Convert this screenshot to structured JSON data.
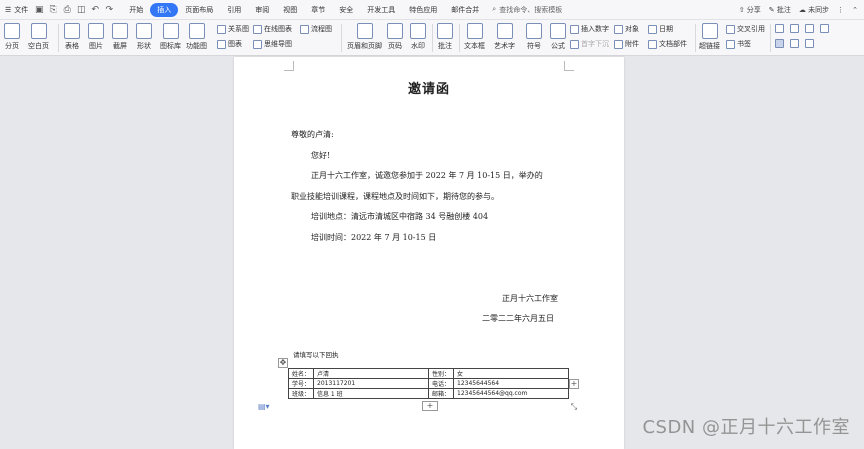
{
  "menubar": {
    "file_label": "文件",
    "tabs": [
      "开始",
      "插入",
      "页面布局",
      "引用",
      "审阅",
      "视图",
      "章节",
      "安全",
      "开发工具",
      "特色应用",
      "邮件合并"
    ],
    "active_tab": "插入",
    "search_placeholder": "查找命令、搜索模板",
    "share": "分享",
    "comment": "批注",
    "sync": "未同步"
  },
  "ribbon": {
    "big": [
      "分页",
      "空白页",
      "表格",
      "图片",
      "截屏",
      "形状",
      "图标库",
      "功能图",
      "页眉和页脚",
      "页码",
      "水印",
      "批注",
      "文本框",
      "艺术字",
      "符号",
      "公式",
      "超链接"
    ],
    "small": [
      "关系图",
      "在线图表",
      "流程图",
      "图表",
      "思维导图",
      "插入数字",
      "对象",
      "日期",
      "首字下沉",
      "附件",
      "文档部件",
      "交叉引用",
      "书签"
    ]
  },
  "document": {
    "title": "邀请函",
    "salutation": "尊敬的卢清:",
    "greeting": "您好!",
    "body_line1": "正月十六工作室，诚邀您参加于 2022 年 7 月 10-15 日，举办的",
    "body_line2": "职业技能培训课程，课程地点及时间如下，期待您的参与。",
    "location": "培训地点：清远市清城区中宿路 34 号融创楼 404",
    "time": "培训时间：2022 年 7 月 10-15 日",
    "signature": "正月十六工作室",
    "date": "二零二二年六月五日",
    "reply_label": "请填写以下回执",
    "reply_table": [
      [
        "姓名：",
        "卢清",
        "性别：",
        "女"
      ],
      [
        "学号：",
        "2013117201",
        "电话：",
        "12345644564"
      ],
      [
        "班级：",
        "信息 1 班",
        "邮箱：",
        "12345644564@qq.com"
      ]
    ]
  },
  "watermark": "CSDN @正月十六工作室"
}
